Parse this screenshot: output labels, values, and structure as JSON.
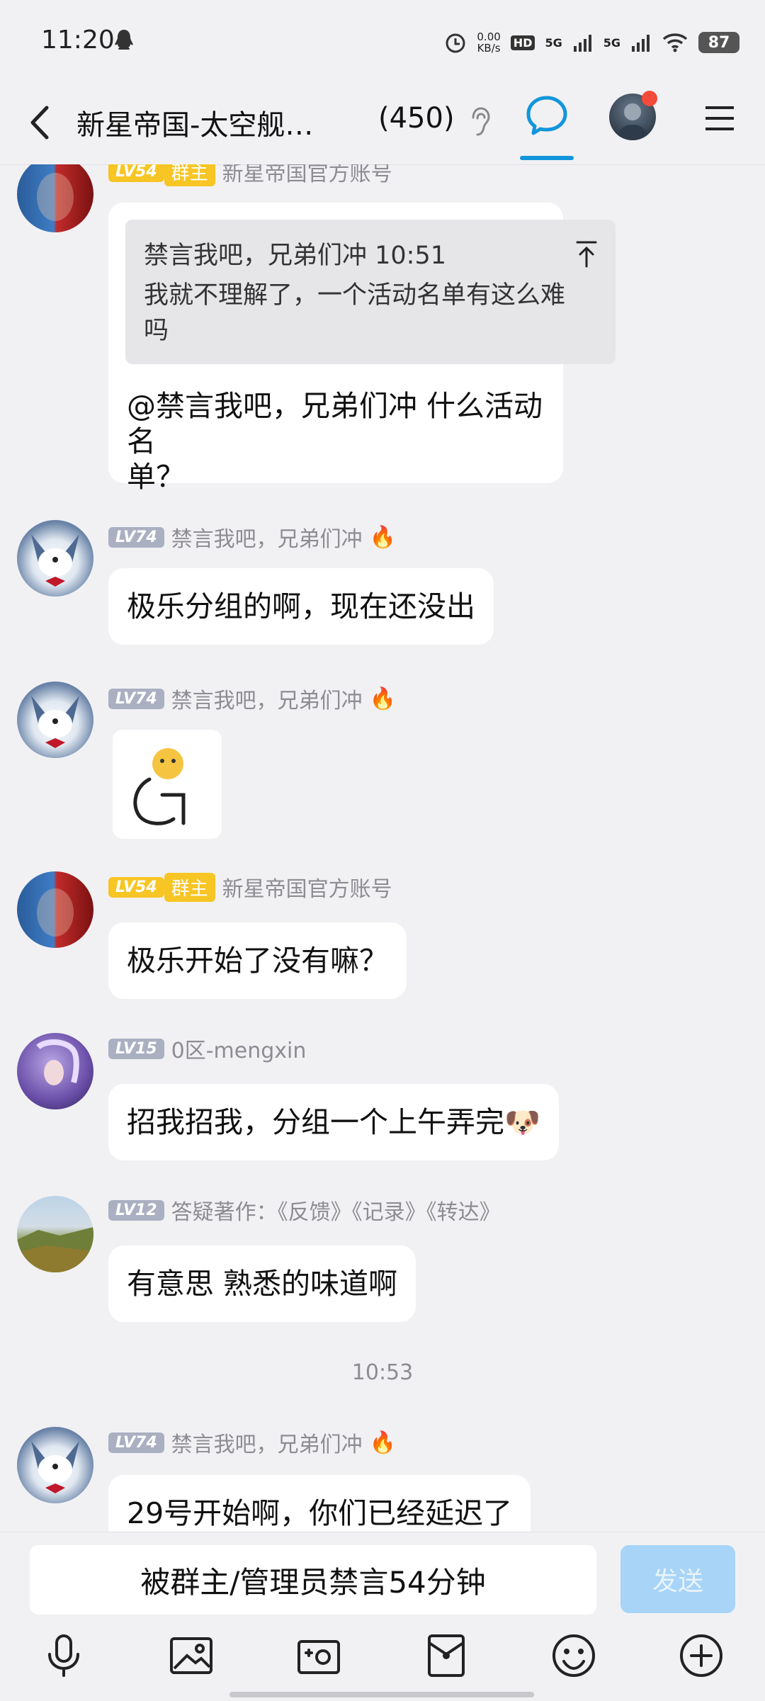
{
  "status_bar": {
    "time": "11:20",
    "netspeed_value": "0.00",
    "netspeed_unit": "KB/s",
    "hd": "HD",
    "sig1": "5G",
    "sig2": "5G",
    "battery": "87"
  },
  "header": {
    "title": "新星帝国-太空舰…",
    "count": "(450)"
  },
  "messages": [
    {
      "level": "LV54",
      "tag": "群主",
      "name": "新星帝国官方账号",
      "quote_head": "禁言我吧，兄弟们冲 10:51",
      "quote_body": "我就不理解了，一个活动名单有这么难吗",
      "text_line1": "@禁言我吧，兄弟们冲 什么活动名",
      "text_line2": "单？"
    },
    {
      "level": "LV74",
      "name": "禁言我吧，兄弟们冲",
      "text": "极乐分组的啊，现在还没出"
    },
    {
      "level": "LV74",
      "name": "禁言我吧，兄弟们冲"
    },
    {
      "level": "LV54",
      "tag": "群主",
      "name": "新星帝国官方账号",
      "text": "极乐开始了没有嘛？"
    },
    {
      "level": "LV15",
      "name": "0区-mengxin",
      "text": "招我招我，分组一个上午弄完🐶"
    },
    {
      "level": "LV12",
      "name": "答疑著作：《反馈》《记录》《转达》",
      "text": "有意思 熟悉的味道啊"
    },
    {
      "time": "10:53"
    },
    {
      "level": "LV74",
      "name": "禁言我吧，兄弟们冲",
      "text": "29号开始啊，你们已经延迟了"
    }
  ],
  "input": {
    "muted_text": "被群主/管理员禁言54分钟",
    "send_label": "发送"
  }
}
